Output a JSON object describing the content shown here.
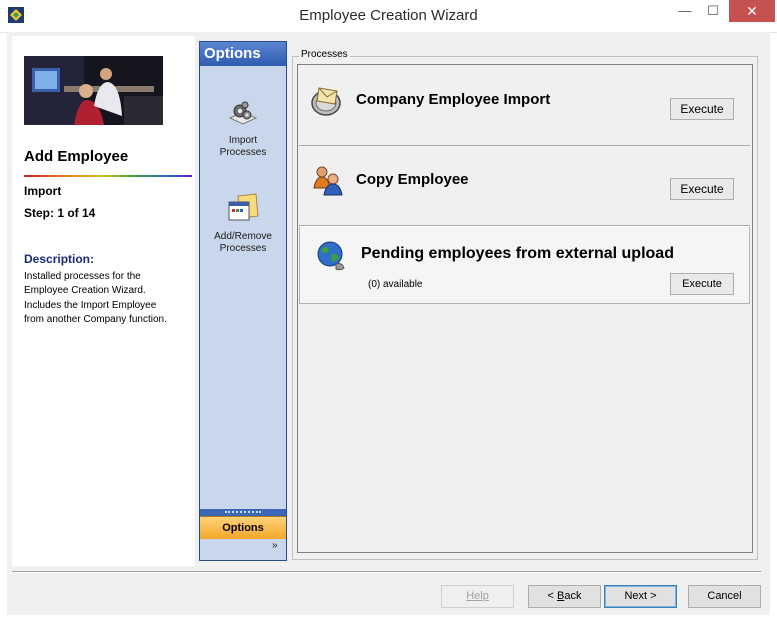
{
  "window": {
    "title": "Employee Creation Wizard",
    "minimize_glyph": "—",
    "maximize_glyph": "☐",
    "close_glyph": "✕"
  },
  "info_panel": {
    "page_title": "Add Employee",
    "step_name": "Import",
    "step_label": "Step: 1 of 14",
    "description_heading": "Description:",
    "description_lines": [
      "Installed processes for the",
      "Employee Creation Wizard.",
      "Includes the Import Employee",
      "from another Company function."
    ]
  },
  "options_bar": {
    "header": "Options",
    "items": [
      {
        "label_1": "Import",
        "label_2": "Processes",
        "icon": "gears-icon"
      },
      {
        "label_1": "Add/Remove",
        "label_2": "Processes",
        "icon": "folder-window-icon"
      }
    ],
    "tab_label": "Options",
    "chevron": "»"
  },
  "processes": {
    "group_label": "Processes",
    "cards": [
      {
        "title": "Company Employee Import",
        "button": "Execute",
        "icon": "envelope-import-icon"
      },
      {
        "title": "Copy Employee",
        "button": "Execute",
        "icon": "users-icon"
      },
      {
        "title": "Pending employees from external upload",
        "subtitle": "(0) available",
        "button": "Execute",
        "icon": "globe-icon"
      }
    ]
  },
  "footer": {
    "help": "Help",
    "back_prefix": "< ",
    "back_accel": "B",
    "back_rest": "ack",
    "next": "Next >",
    "cancel": "Cancel"
  },
  "colors": {
    "options_header": "#2d5bb0",
    "options_tab": "#f3a726",
    "close_button": "#c75050",
    "description_heading": "#1a2a7a"
  }
}
